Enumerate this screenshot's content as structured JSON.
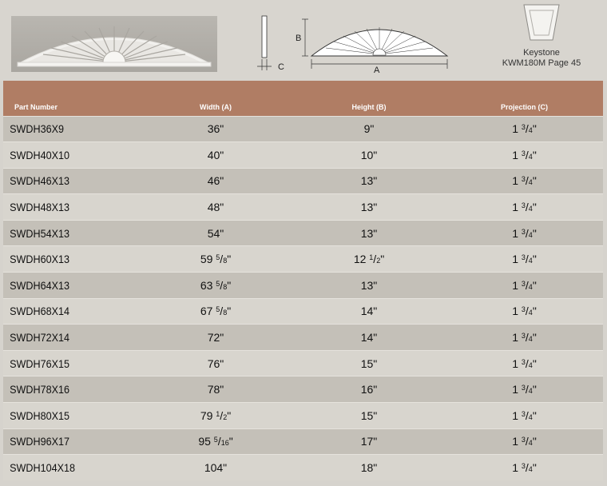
{
  "keystone": {
    "title": "Keystone",
    "ref": "KWM180M Page 45"
  },
  "diagram": {
    "label_a": "A",
    "label_b": "B",
    "label_c": "C"
  },
  "table": {
    "headers": {
      "part": "Part Number",
      "width": "Width (A)",
      "height": "Height (B)",
      "projection": "Projection (C)"
    },
    "rows": [
      {
        "part": "SWDH36X9",
        "width": "36\"",
        "height": "9\"",
        "projection": "1 3/4\""
      },
      {
        "part": "SWDH40X10",
        "width": "40\"",
        "height": "10\"",
        "projection": "1 3/4\""
      },
      {
        "part": "SWDH46X13",
        "width": "46\"",
        "height": "13\"",
        "projection": "1 3/4\""
      },
      {
        "part": "SWDH48X13",
        "width": "48\"",
        "height": "13\"",
        "projection": "1 3/4\""
      },
      {
        "part": "SWDH54X13",
        "width": "54\"",
        "height": "13\"",
        "projection": "1 3/4\""
      },
      {
        "part": "SWDH60X13",
        "width": "59 5/8\"",
        "height": "12 1/2\"",
        "projection": "1 3/4\""
      },
      {
        "part": "SWDH64X13",
        "width": "63 5/8\"",
        "height": "13\"",
        "projection": "1 3/4\""
      },
      {
        "part": "SWDH68X14",
        "width": "67 5/8\"",
        "height": "14\"",
        "projection": "1 3/4\""
      },
      {
        "part": "SWDH72X14",
        "width": "72\"",
        "height": "14\"",
        "projection": "1 3/4\""
      },
      {
        "part": "SWDH76X15",
        "width": "76\"",
        "height": "15\"",
        "projection": "1 3/4\""
      },
      {
        "part": "SWDH78X16",
        "width": "78\"",
        "height": "16\"",
        "projection": "1 3/4\""
      },
      {
        "part": "SWDH80X15",
        "width": "79 1/2\"",
        "height": "15\"",
        "projection": "1 3/4\""
      },
      {
        "part": "SWDH96X17",
        "width": "95 5/16\"",
        "height": "17\"",
        "projection": "1 3/4\""
      },
      {
        "part": "SWDH104X18",
        "width": "104\"",
        "height": "18\"",
        "projection": "1 3/4\""
      }
    ]
  },
  "colors": {
    "header_bg": "#b07d64",
    "row_dark": "#c4c0b8",
    "row_light": "#d8d5ce"
  }
}
